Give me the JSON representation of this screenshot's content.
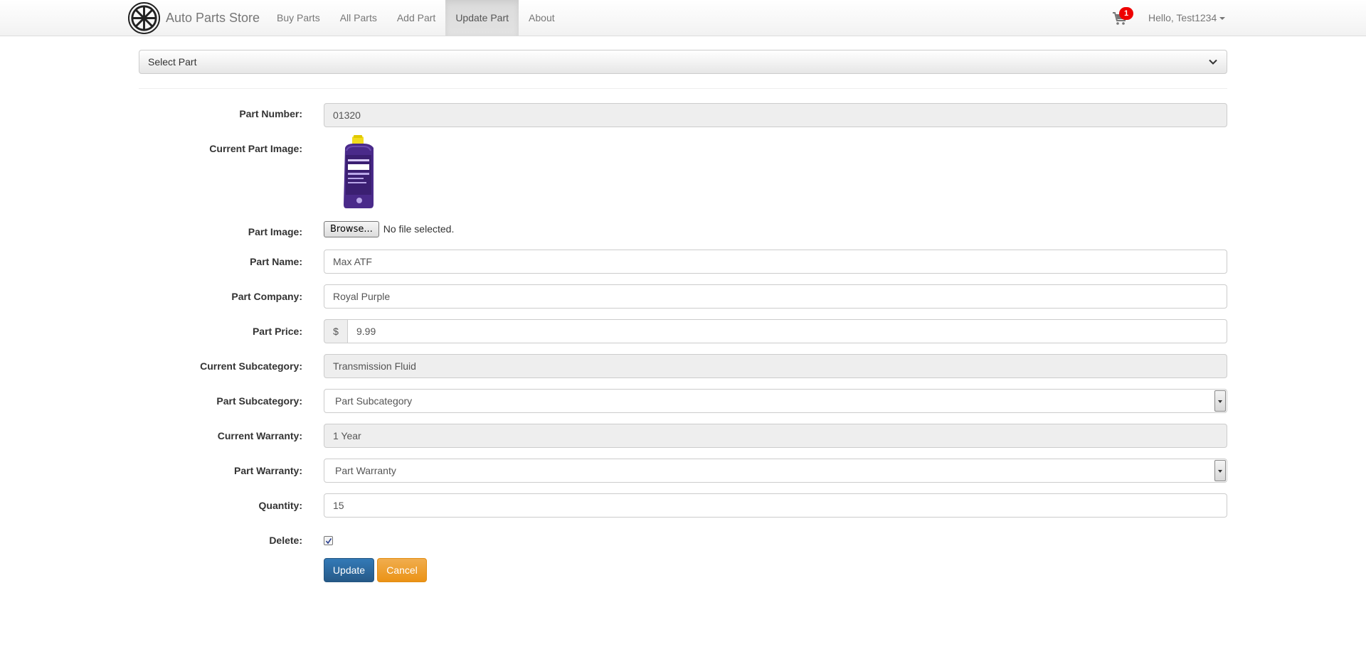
{
  "navbar": {
    "brand": "Auto Parts Store",
    "items": [
      {
        "label": "Buy Parts"
      },
      {
        "label": "All Parts"
      },
      {
        "label": "Add Part"
      },
      {
        "label": "Update Part",
        "active": true
      },
      {
        "label": "About"
      }
    ],
    "cart_count": "1",
    "user_greeting": "Hello, Test1234"
  },
  "select_part": {
    "label": "Select Part"
  },
  "form": {
    "part_number": {
      "label": "Part Number:",
      "value": "01320"
    },
    "current_image": {
      "label": "Current Part Image:"
    },
    "part_image": {
      "label": "Part Image:",
      "button": "Browse...",
      "status": "No file selected."
    },
    "part_name": {
      "label": "Part Name:",
      "value": "Max ATF"
    },
    "part_company": {
      "label": "Part Company:",
      "value": "Royal Purple"
    },
    "part_price": {
      "label": "Part Price:",
      "currency": "$",
      "value": "9.99"
    },
    "current_subcategory": {
      "label": "Current Subcategory:",
      "value": "Transmission Fluid"
    },
    "part_subcategory": {
      "label": "Part Subcategory:",
      "value": "Part Subcategory"
    },
    "current_warranty": {
      "label": "Current Warranty:",
      "value": "1 Year"
    },
    "part_warranty": {
      "label": "Part Warranty:",
      "value": "Part Warranty"
    },
    "quantity": {
      "label": "Quantity:",
      "value": "15"
    },
    "delete": {
      "label": "Delete:",
      "checked": true
    }
  },
  "buttons": {
    "update": "Update",
    "cancel": "Cancel"
  },
  "product_image_text": {
    "top": "ROYAL PURPLE",
    "bottom": "MAX ATF"
  },
  "colors": {
    "primary": "#337ab7",
    "warning": "#f0ad4e",
    "badge": "#ee0000",
    "bottle": "#4a2a8a",
    "cap": "#f2dc1d"
  }
}
